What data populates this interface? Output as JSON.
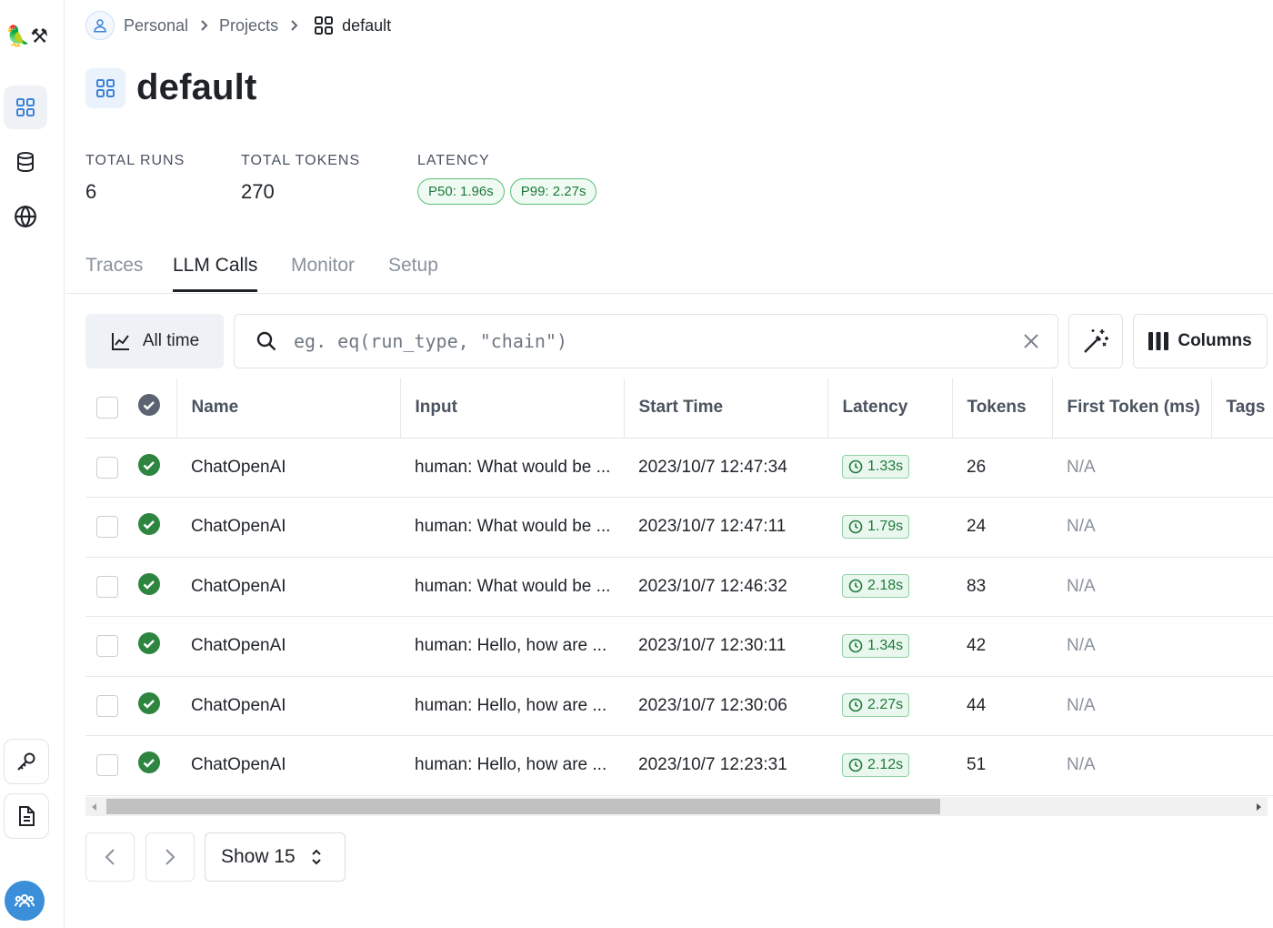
{
  "app": {
    "logo": "🦜⚒"
  },
  "breadcrumb": {
    "items": [
      "Personal",
      "Projects"
    ],
    "current": "default"
  },
  "page": {
    "title": "default"
  },
  "stats": {
    "total_runs_label": "TOTAL RUNS",
    "total_runs_value": "6",
    "total_tokens_label": "TOTAL TOKENS",
    "total_tokens_value": "270",
    "latency_label": "LATENCY",
    "p50": "P50: 1.96s",
    "p99": "P99: 2.27s"
  },
  "tabs": [
    "Traces",
    "LLM Calls",
    "Monitor",
    "Setup"
  ],
  "active_tab": "LLM Calls",
  "toolbar": {
    "time_range": "All time",
    "search_placeholder": "eg. eq(run_type, \"chain\")",
    "columns_label": "Columns"
  },
  "table": {
    "columns": [
      "Name",
      "Input",
      "Start Time",
      "Latency",
      "Tokens",
      "First Token (ms)",
      "Tags"
    ],
    "rows": [
      {
        "name": "ChatOpenAI",
        "input": "human: What would be ...",
        "start_time": "2023/10/7 12:47:34",
        "latency": "1.33s",
        "tokens": "26",
        "first_token": "N/A"
      },
      {
        "name": "ChatOpenAI",
        "input": "human: What would be ...",
        "start_time": "2023/10/7 12:47:11",
        "latency": "1.79s",
        "tokens": "24",
        "first_token": "N/A"
      },
      {
        "name": "ChatOpenAI",
        "input": "human: What would be ...",
        "start_time": "2023/10/7 12:46:32",
        "latency": "2.18s",
        "tokens": "83",
        "first_token": "N/A"
      },
      {
        "name": "ChatOpenAI",
        "input": "human: Hello, how are ...",
        "start_time": "2023/10/7 12:30:11",
        "latency": "1.34s",
        "tokens": "42",
        "first_token": "N/A"
      },
      {
        "name": "ChatOpenAI",
        "input": "human: Hello, how are ...",
        "start_time": "2023/10/7 12:30:06",
        "latency": "2.27s",
        "tokens": "44",
        "first_token": "N/A"
      },
      {
        "name": "ChatOpenAI",
        "input": "human: Hello, how are ...",
        "start_time": "2023/10/7 12:23:31",
        "latency": "2.12s",
        "tokens": "51",
        "first_token": "N/A"
      }
    ]
  },
  "pagination": {
    "page_size_label": "Show 15"
  },
  "colors": {
    "success": "#2e8540",
    "accent": "#3b8fd8",
    "pill_border": "#5cc177"
  },
  "icons": {
    "sidebar": [
      "projects-icon",
      "datasets-icon",
      "hub-icon",
      "api-key-icon",
      "docs-icon",
      "organization-icon"
    ],
    "toolbar": [
      "chart-line-icon",
      "search-icon",
      "clear-icon",
      "magic-wand-icon",
      "columns-icon"
    ]
  }
}
